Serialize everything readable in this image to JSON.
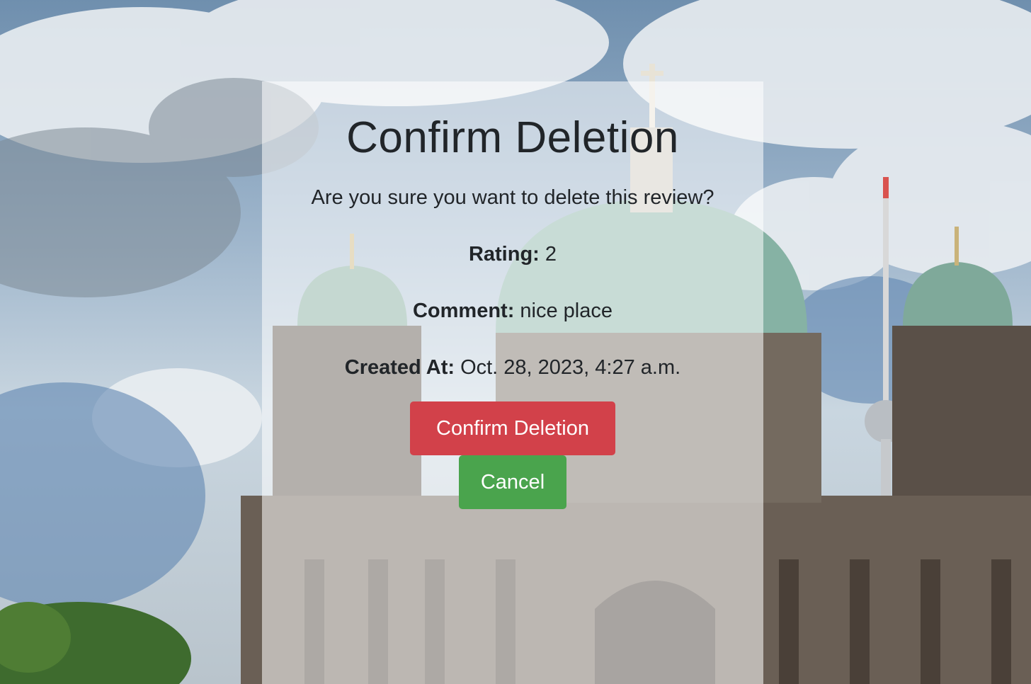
{
  "page": {
    "title": "Confirm Deletion",
    "question": "Are you sure you want to delete this review?"
  },
  "review": {
    "rating_label": "Rating:",
    "rating_value": "2",
    "comment_label": "Comment:",
    "comment_value": "nice place",
    "created_label": "Created At:",
    "created_value": "Oct. 28, 2023, 4:27 a.m."
  },
  "actions": {
    "confirm_label": "Confirm Deletion",
    "cancel_label": "Cancel"
  },
  "colors": {
    "danger": "#d2414a",
    "success": "#4aa44d",
    "text": "#212529"
  },
  "background": {
    "icon": "cathedral-photo"
  }
}
